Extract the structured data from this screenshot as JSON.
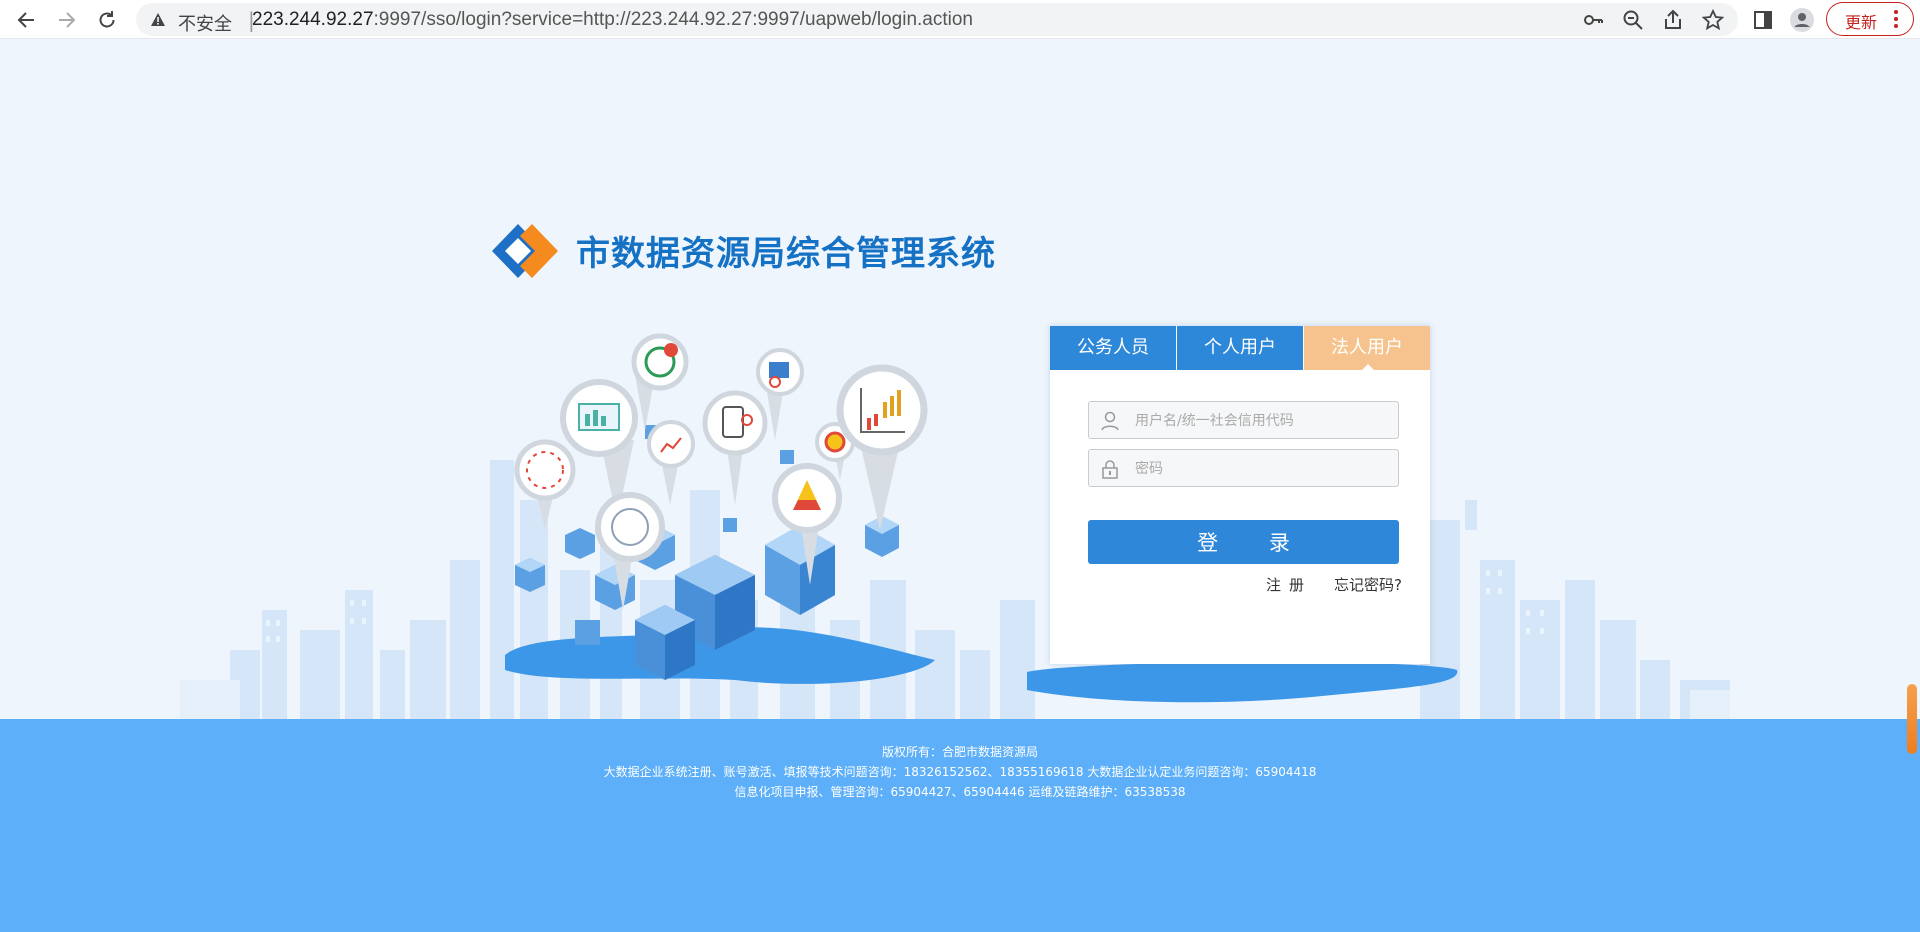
{
  "browser": {
    "insecure_label": "不安全",
    "url_host": "223.244.92.27",
    "url_rest": ":9997/sso/login?service=http://223.244.92.27:9997/uapweb/login.action",
    "update_label": "更新",
    "icons": [
      "back-icon",
      "forward-icon",
      "reload-icon",
      "warning-icon",
      "key-icon",
      "zoom-out-icon",
      "share-icon",
      "star-icon",
      "side-panel-icon",
      "profile-icon",
      "more-icon"
    ]
  },
  "header": {
    "system_title": "市数据资源局综合管理系统"
  },
  "login": {
    "tabs": [
      {
        "label": "公务人员",
        "active": false
      },
      {
        "label": "个人用户",
        "active": false
      },
      {
        "label": "法人用户",
        "active": true
      }
    ],
    "username_placeholder": "用户名/统一社会信用代码",
    "password_placeholder": "密码",
    "submit_label": "登 录",
    "register_label": "注册",
    "forgot_label": "忘记密码?"
  },
  "footer": {
    "line1": "版权所有：合肥市数据资源局",
    "line2": "大数据企业系统注册、账号激活、填报等技术问题咨询：18326152562、18355169618   大数据企业认定业务问题咨询：65904418",
    "line3": "信息化项目申报、管理咨询：65904427、65904446   运维及链路维护：63538538"
  },
  "colors": {
    "primary": "#2d88da",
    "active_tab": "#f6c38e",
    "footer": "#5caff8",
    "background": "#eef5fd",
    "title": "#1571c4"
  }
}
